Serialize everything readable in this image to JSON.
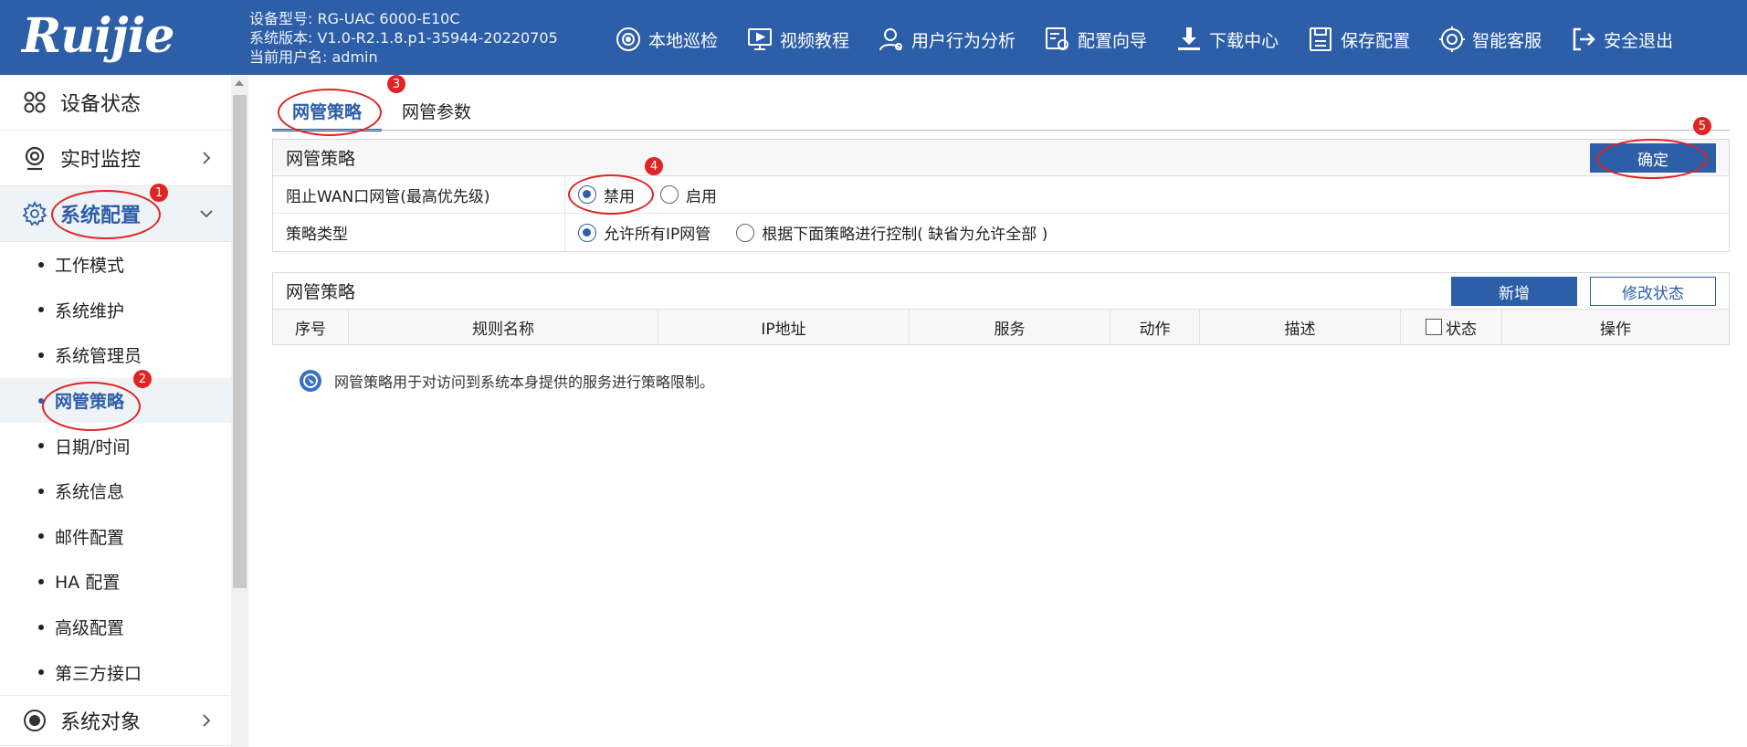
{
  "header": {
    "logo": "Ruijie",
    "device_model": "设备型号: RG-UAC 6000-E10C",
    "system_version": "系统版本: V1.0-R2.1.8.p1-35944-20220705",
    "current_user": "当前用户名: admin",
    "nav": [
      {
        "label": "本地巡检",
        "icon": "local-inspection-icon"
      },
      {
        "label": "视频教程",
        "icon": "video-tutorial-icon"
      },
      {
        "label": "用户行为分析",
        "icon": "user-behavior-icon"
      },
      {
        "label": "配置向导",
        "icon": "config-wizard-icon"
      },
      {
        "label": "下载中心",
        "icon": "download-icon"
      },
      {
        "label": "保存配置",
        "icon": "save-icon"
      },
      {
        "label": "智能客服",
        "icon": "customer-service-icon"
      },
      {
        "label": "安全退出",
        "icon": "logout-icon"
      }
    ]
  },
  "sidebar": {
    "device_status": "设备状态",
    "realtime_monitor": "实时监控",
    "system_config": "系统配置",
    "sub_items": [
      "工作模式",
      "系统维护",
      "系统管理员",
      "网管策略",
      "日期/时间",
      "系统信息",
      "邮件配置",
      "HA 配置",
      "高级配置",
      "第三方接口"
    ],
    "active_sub": "网管策略",
    "system_objects": "系统对象"
  },
  "tabs": [
    "网管策略",
    "网管参数"
  ],
  "policy_panel": {
    "title": "网管策略",
    "confirm_label": "确定",
    "rows": [
      {
        "label": "阻止WAN口网管(最高优先级)",
        "options": [
          "禁用",
          "启用"
        ],
        "selected": "禁用"
      },
      {
        "label": "策略类型",
        "options": [
          "允许所有IP网管",
          "根据下面策略进行控制( 缺省为允许全部 )"
        ],
        "selected": "允许所有IP网管"
      }
    ]
  },
  "rules_panel": {
    "title": "网管策略",
    "add_label": "新增",
    "modify_status_label": "修改状态",
    "columns": [
      "序号",
      "规则名称",
      "IP地址",
      "服务",
      "动作",
      "描述",
      "状态",
      "操作"
    ]
  },
  "tip": "网管策略用于对访问到系统本身提供的服务进行策略限制。",
  "annotations": [
    "1",
    "2",
    "3",
    "4",
    "5"
  ],
  "colors": {
    "brand": "#2d5ea8",
    "annotation": "#e02424"
  }
}
